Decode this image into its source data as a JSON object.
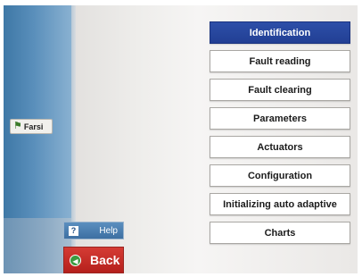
{
  "sidebar": {
    "language_button": {
      "label": "Farsi",
      "icon": "farsi-flag-icon"
    },
    "help_button": {
      "label": "Help",
      "icon": "question-icon"
    },
    "back_button": {
      "label": "Back",
      "icon": "back-arrow-icon"
    }
  },
  "menu": {
    "items": [
      {
        "label": "Identification",
        "active": true
      },
      {
        "label": "Fault reading"
      },
      {
        "label": "Fault clearing"
      },
      {
        "label": "Parameters"
      },
      {
        "label": "Actuators"
      },
      {
        "label": "Configuration"
      },
      {
        "label": "Initializing auto adaptive"
      },
      {
        "label": "Charts"
      }
    ]
  },
  "colors": {
    "active_item": "#223f94",
    "sidebar": "#5a8fbb",
    "back_button": "#c22a25",
    "help_button": "#3d6fa2"
  }
}
